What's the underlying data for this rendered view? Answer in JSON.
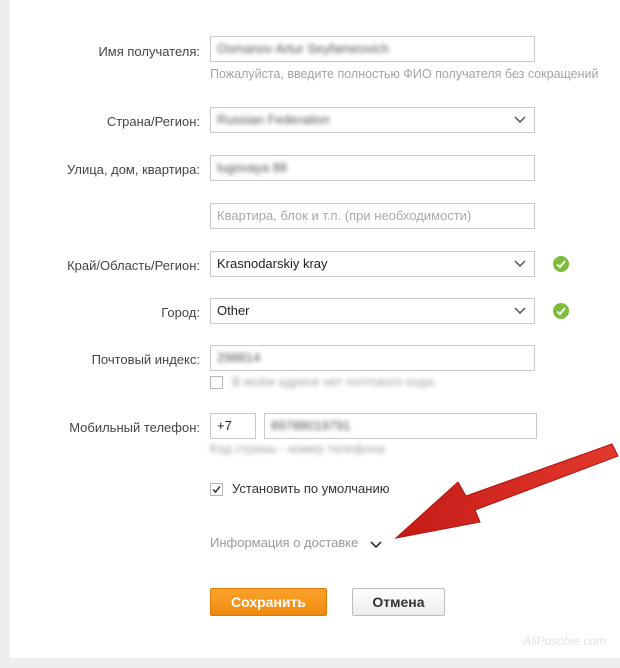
{
  "form": {
    "recipient_label": "Имя получателя:",
    "recipient_value": "Osmanov Artur Seyfameovich",
    "recipient_hint": "Пожалуйста, введите полностью ФИО получателя без сокращений",
    "country_label": "Страна/Регион:",
    "country_value": "Russian Federation",
    "street_label": "Улица, дом, квартира:",
    "street_value": "lugovaya 88",
    "apartment_placeholder": "Квартира, блок и т.п. (при необходимости)",
    "region_label": "Край/Область/Регион:",
    "region_value": "Krasnodarskiy kray",
    "city_label": "Город:",
    "city_value": "Other",
    "zip_label": "Почтовый индекс:",
    "zip_value": "298814",
    "no_zip_label": "В моём адресе нет почтового кода.",
    "phone_label": "Мобильный телефон:",
    "phone_code": "+7",
    "phone_number": "89788019791",
    "phone_hint": "Код страны - номер телефона",
    "default_label": "Установить по умолчанию",
    "delivery_info": "Информация о доставке"
  },
  "buttons": {
    "save": "Сохранить",
    "cancel": "Отмена"
  },
  "watermark": "AliPosobie.com",
  "colors": {
    "accent": "#f5941c",
    "valid": "#7cbd3a",
    "arrow": "#d8261f"
  }
}
